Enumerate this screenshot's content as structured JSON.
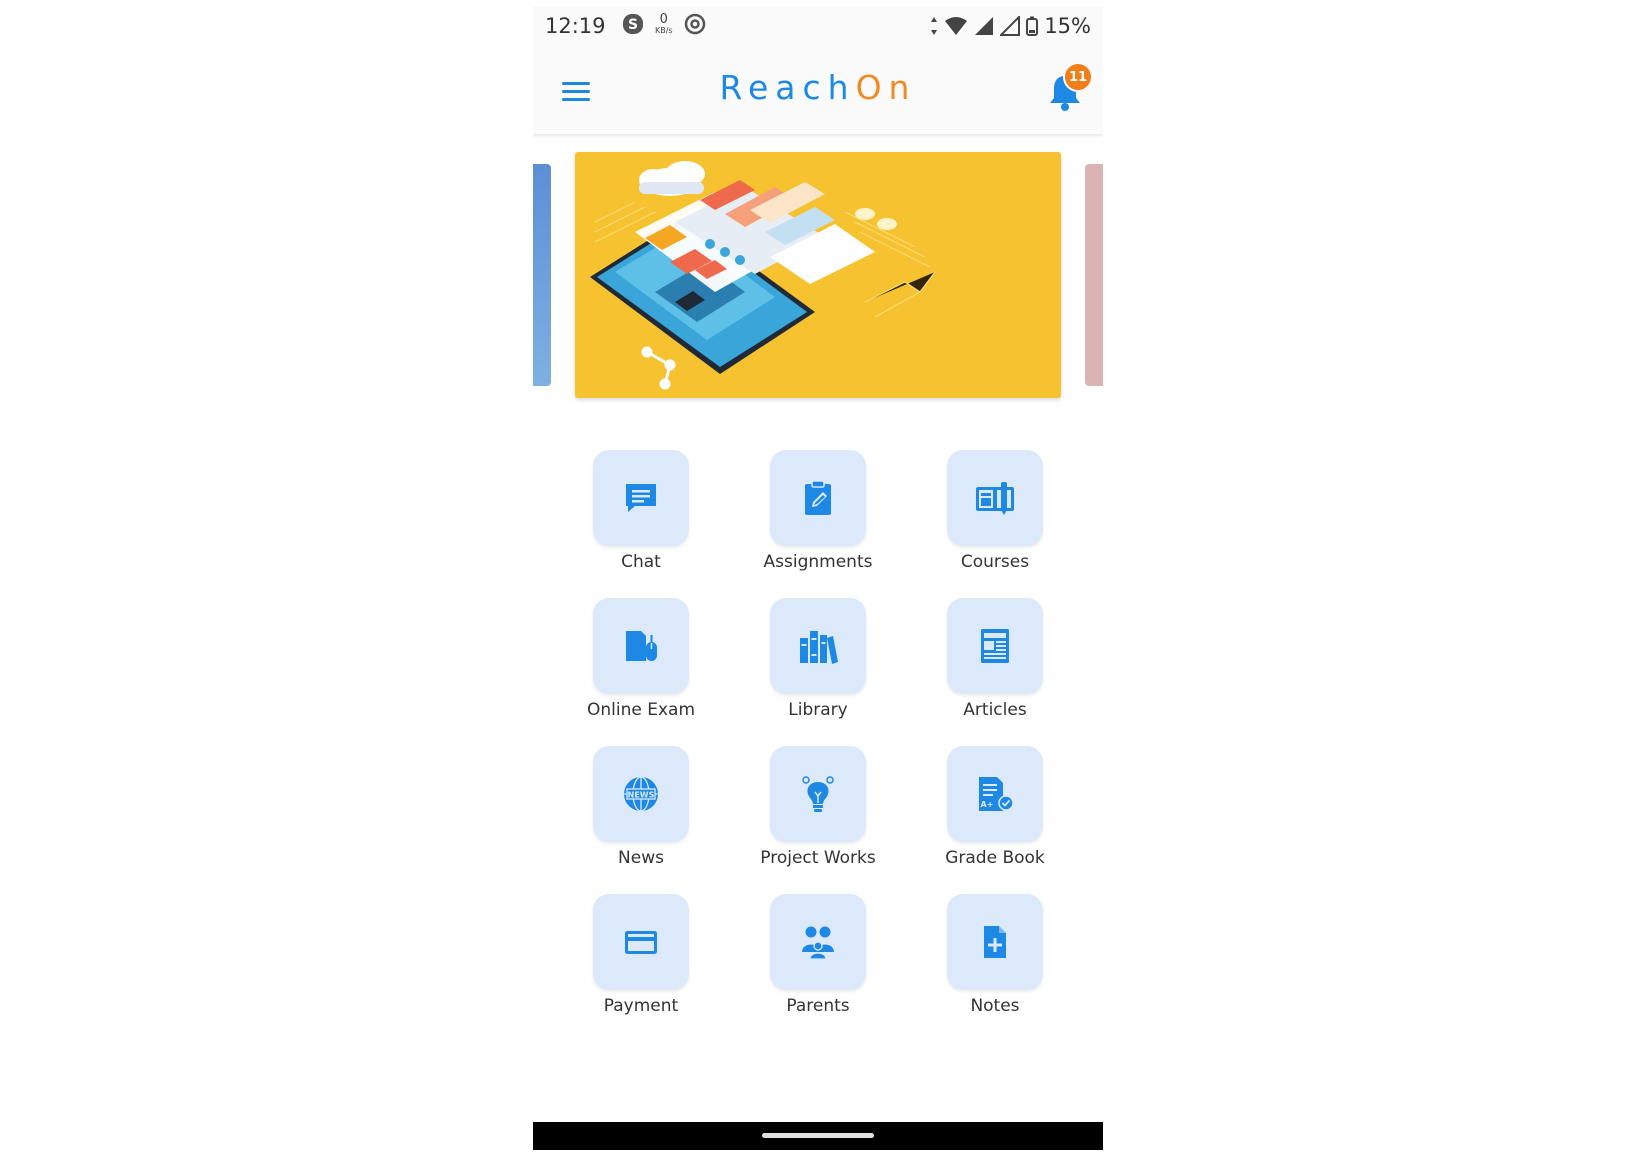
{
  "status_bar": {
    "time": "12:19",
    "net_speed_value": "0",
    "net_speed_unit": "KB/s",
    "battery": "15%"
  },
  "header": {
    "brand_part1": "Reach",
    "brand_part2": "On",
    "notification_count": "11"
  },
  "colors": {
    "brand_blue": "#1e88e5",
    "brand_orange": "#f08a24",
    "tile_background": "#dbe9fb",
    "banner_yellow": "#f6c22f"
  },
  "menu": [
    {
      "label": "Chat",
      "icon": "chat-icon"
    },
    {
      "label": "Assignments",
      "icon": "clipboard-edit-icon"
    },
    {
      "label": "Courses",
      "icon": "book-pencil-icon"
    },
    {
      "label": "Online Exam",
      "icon": "exam-mouse-icon"
    },
    {
      "label": "Library",
      "icon": "books-icon"
    },
    {
      "label": "Articles",
      "icon": "article-icon"
    },
    {
      "label": "News",
      "icon": "globe-news-icon"
    },
    {
      "label": "Project Works",
      "icon": "lightbulb-icon"
    },
    {
      "label": "Grade Book",
      "icon": "gradebook-icon"
    },
    {
      "label": "Payment",
      "icon": "credit-card-icon"
    },
    {
      "label": "Parents",
      "icon": "parents-icon"
    },
    {
      "label": "Notes",
      "icon": "note-add-icon"
    }
  ]
}
